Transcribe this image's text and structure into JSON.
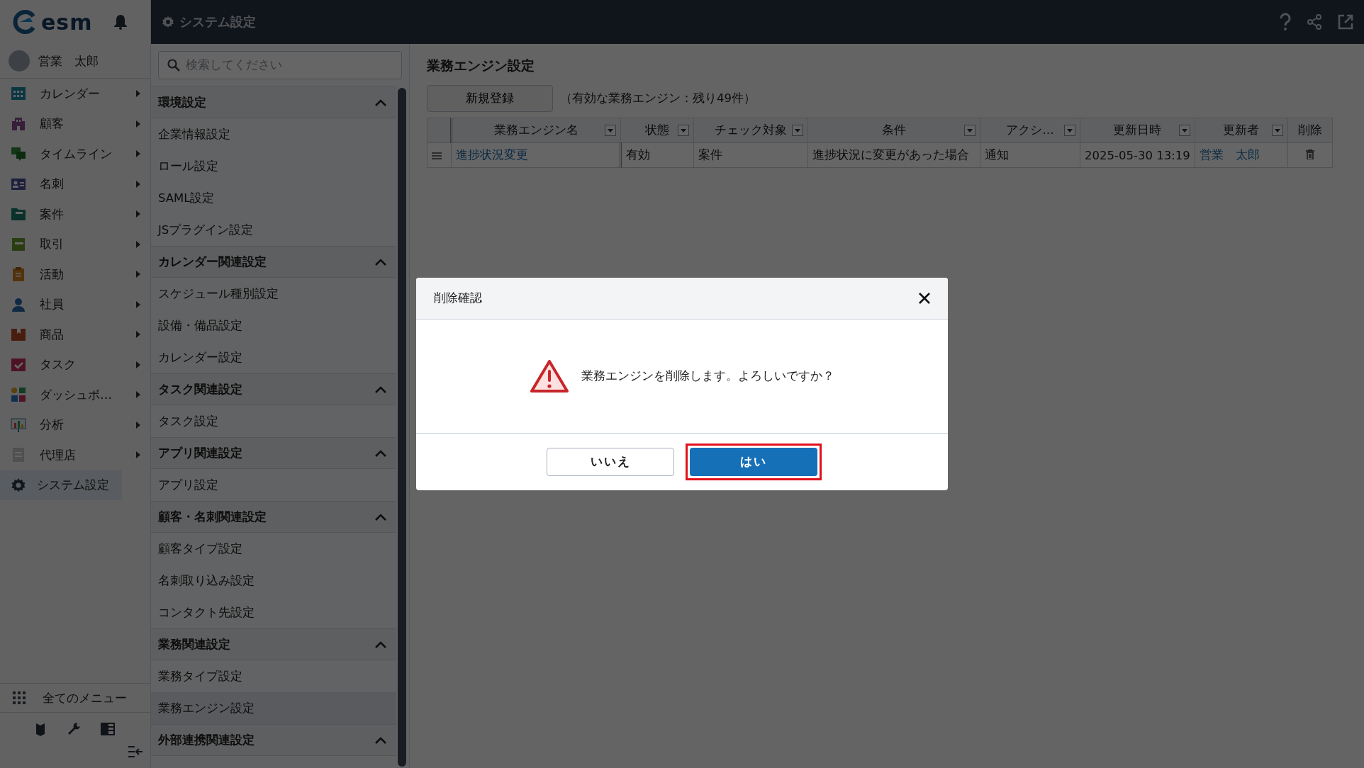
{
  "sidebar": {
    "logo": "esm",
    "user": "営業　太郎",
    "items": [
      {
        "label": "カレンダー",
        "selected": false
      },
      {
        "label": "顧客",
        "selected": false
      },
      {
        "label": "タイムライン",
        "selected": false
      },
      {
        "label": "名刺",
        "selected": false
      },
      {
        "label": "案件",
        "selected": false
      },
      {
        "label": "取引",
        "selected": false
      },
      {
        "label": "活動",
        "selected": false
      },
      {
        "label": "社員",
        "selected": false
      },
      {
        "label": "商品",
        "selected": false
      },
      {
        "label": "タスク",
        "selected": false
      },
      {
        "label": "ダッシュボ…",
        "selected": false
      },
      {
        "label": "分析",
        "selected": false
      },
      {
        "label": "代理店",
        "selected": false
      },
      {
        "label": "システム設定",
        "selected": true
      }
    ],
    "all_menu": "全てのメニュー"
  },
  "header": {
    "title": "システム設定"
  },
  "settings_menu": {
    "search": {
      "placeholder": "検索してください"
    },
    "groups": [
      {
        "title": "環境設定",
        "expanded": true,
        "items": [
          {
            "label": "企業情報設定",
            "selected": false
          },
          {
            "label": "ロール設定",
            "selected": false
          },
          {
            "label": "SAML設定",
            "selected": false
          },
          {
            "label": "JSプラグイン設定",
            "selected": false
          }
        ]
      },
      {
        "title": "カレンダー関連設定",
        "expanded": true,
        "items": [
          {
            "label": "スケジュール種別設定",
            "selected": false
          },
          {
            "label": "設備・備品設定",
            "selected": false
          },
          {
            "label": "カレンダー設定",
            "selected": false
          }
        ]
      },
      {
        "title": "タスク関連設定",
        "expanded": true,
        "items": [
          {
            "label": "タスク設定",
            "selected": false
          }
        ]
      },
      {
        "title": "アプリ関連設定",
        "expanded": true,
        "items": [
          {
            "label": "アプリ設定",
            "selected": false
          }
        ]
      },
      {
        "title": "顧客・名刺関連設定",
        "expanded": true,
        "items": [
          {
            "label": "顧客タイプ設定",
            "selected": false
          },
          {
            "label": "名刺取り込み設定",
            "selected": false
          },
          {
            "label": "コンタクト先設定",
            "selected": false
          }
        ]
      },
      {
        "title": "業務関連設定",
        "expanded": true,
        "items": [
          {
            "label": "業務タイプ設定",
            "selected": false
          },
          {
            "label": "業務エンジン設定",
            "selected": true
          }
        ]
      },
      {
        "title": "外部連携関連設定",
        "expanded": true
      }
    ]
  },
  "main": {
    "title": "業務エンジン設定",
    "new_button": "新規登録",
    "note": "（有効な業務エンジン：残り49件）",
    "table": {
      "columns": [
        {
          "label": "業務エンジン名",
          "filter": true
        },
        {
          "label": "状態",
          "filter": true
        },
        {
          "label": "チェック対象",
          "filter": true
        },
        {
          "label": "条件",
          "filter": true
        },
        {
          "label": "アクシ…",
          "filter": true
        },
        {
          "label": "更新日時",
          "filter": true
        },
        {
          "label": "更新者",
          "filter": true
        },
        {
          "label": "削除",
          "filter": false
        }
      ],
      "rows": [
        {
          "cells": [
            "進捗状況変更",
            "有効",
            "案件",
            "進捗状況に変更があった場合",
            "通知",
            "2025-05-30 13:19",
            "営業　太郎"
          ]
        }
      ]
    }
  },
  "dialog": {
    "title": "削除確認",
    "message": "業務エンジンを削除します。よろしいですか？",
    "buttons": [
      {
        "label": "いいえ",
        "kind": "secondary",
        "highlighted": false
      },
      {
        "label": "はい",
        "kind": "primary",
        "highlighted": true
      }
    ]
  }
}
